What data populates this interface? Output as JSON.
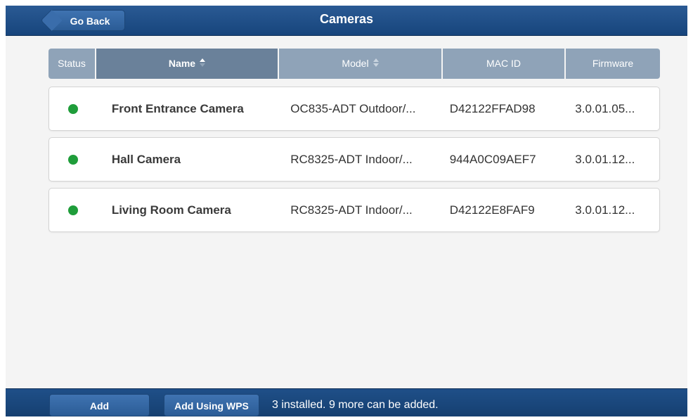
{
  "header": {
    "title": "Cameras",
    "back_label": "Go Back"
  },
  "table": {
    "columns": [
      {
        "label": "Status"
      },
      {
        "label": "Name"
      },
      {
        "label": "Model"
      },
      {
        "label": "MAC ID"
      },
      {
        "label": "Firmware"
      }
    ],
    "rows": [
      {
        "status": "online",
        "name": "Front Entrance Camera",
        "model": "OC835-ADT Outdoor/...",
        "mac": "D42122FFAD98",
        "firmware": "3.0.01.05..."
      },
      {
        "status": "online",
        "name": "Hall Camera",
        "model": "RC8325-ADT Indoor/...",
        "mac": "944A0C09AEF7",
        "firmware": "3.0.01.12..."
      },
      {
        "status": "online",
        "name": "Living Room Camera",
        "model": "RC8325-ADT Indoor/...",
        "mac": "D42122E8FAF9",
        "firmware": "3.0.01.12..."
      }
    ]
  },
  "footer": {
    "add_label": "Add",
    "add_wps_label": "Add Using WPS",
    "status_text": "3 installed.  9 more can be added."
  },
  "colors": {
    "bar_blue": "#1a477e",
    "header_active": "#6a819a",
    "header_inactive": "#8fa3b8",
    "status_online": "#1f9d3a"
  },
  "icons": {
    "status": "status-dot-icon",
    "sort": "sort-arrows-icon"
  }
}
